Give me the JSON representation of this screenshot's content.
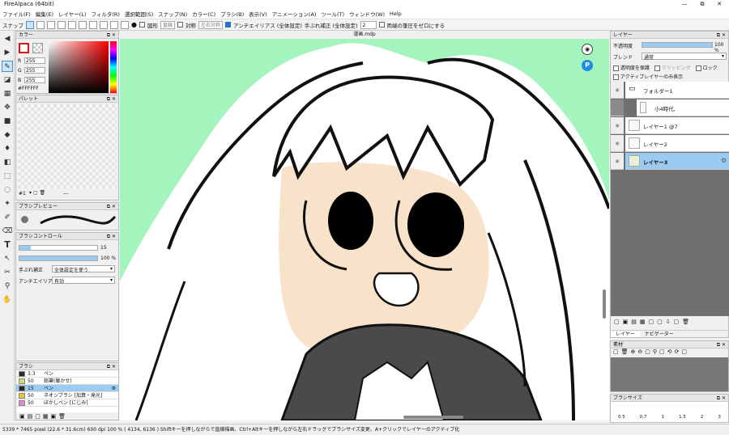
{
  "app": {
    "title": "FireAlpaca (64bit)"
  },
  "window_controls": [
    "—",
    "⧉",
    "✕"
  ],
  "menu": [
    "ファイル(F)",
    "編集(E)",
    "レイヤー(L)",
    "フィルタ(R)",
    "選択範囲(S)",
    "スナップ(N)",
    "カラー(C)",
    "ブラシ(B)",
    "表示(V)",
    "アニメーション(A)",
    "ツール(T)",
    "ウィンドウ(W)",
    "Help"
  ],
  "toolbar": {
    "snap_label": "スナップ",
    "shape_label": "図形",
    "shape_value": "直線",
    "symmetry_label": "対称",
    "symmetry_value": "左右対称",
    "antialias_label": "アンチエイリアス (全体設定)",
    "stabilizer_label": "手ぶれ補正 (全体設定)",
    "stabilizer_value": "2",
    "pressure_label": "両端の筆圧をゼロにする"
  },
  "canvas": {
    "doc_title": "漫画.mdp"
  },
  "color_panel": {
    "title": "カラー",
    "r_label": "R",
    "r": "255",
    "g_label": "G",
    "g": "255",
    "b_label": "B",
    "b": "255",
    "hex": "#FFFFFF"
  },
  "palette_panel": {
    "title": "パレット",
    "set": "#1",
    "suffix": "---"
  },
  "brush_preview": {
    "title": "ブラシプレビュー"
  },
  "brush_control": {
    "title": "ブラシコントロール",
    "size": "15",
    "opacity": "100 %",
    "stab_label": "手ぶれ補正",
    "stab_value": "全体設定を使う",
    "aa_label": "アンチエイリアス",
    "aa_value": "有効"
  },
  "brush_list": {
    "title": "ブラシ",
    "items": [
      {
        "size": "3.3",
        "name": "ペン",
        "color": "#2a2a2a"
      },
      {
        "size": "50",
        "name": "鉛筆(暈かせ)",
        "color": "#c8e07a"
      },
      {
        "size": "15",
        "name": "ペン",
        "color": "#2a2a2a"
      },
      {
        "size": "50",
        "name": "ネオンブラシ [加算・発光]",
        "color": "#e6c82a"
      },
      {
        "size": "50",
        "name": "ぼかしペン [にじみ]",
        "color": "#e888d0"
      }
    ],
    "selected": 2
  },
  "layer_panel": {
    "title": "レイヤー",
    "opacity_label": "不透明度",
    "opacity_value": "100 %",
    "blend_label": "ブレンド",
    "blend_value": "通常",
    "protect_label": "透明度を保護",
    "clip_label": "クリッピング",
    "lock_label": "ロック",
    "active_only_label": "アクティブレイヤーのみ表示",
    "layers": [
      {
        "name": "フォルダー1"
      },
      {
        "name": "小4時代,"
      },
      {
        "name": "レイヤー1 @7"
      },
      {
        "name": "レイヤー2"
      },
      {
        "name": "レイヤー3"
      }
    ],
    "tab_layers": "レイヤー",
    "tab_navigator": "ナビゲーター"
  },
  "material_panel": {
    "title": "素材"
  },
  "brush_size_panel": {
    "title": "ブラシサイズ",
    "sizes": [
      "0.5",
      "0.7",
      "1",
      "1.5",
      "2",
      "3"
    ]
  },
  "status": {
    "text": "5339 * 7465 pixel   (22.6 * 31.6cm)   600 dpi   100 %   ( 4134, 6136 )   Shiftキーを押しながらで直線描画、Ctrl+Altキーを押しながら左右ドラッグでブラシサイズ変更、A+クリックでレイヤーのアクティブ化"
  },
  "colors": {
    "bg_green": "#a3f5bd",
    "skin": "#f9e2ca",
    "shirt": "#4a4a4a",
    "accent": "#4a8ed8",
    "selected_layer": "#9ccbf2"
  }
}
